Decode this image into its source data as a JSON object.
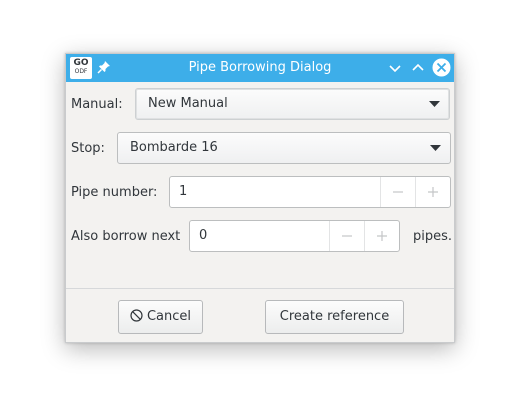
{
  "window": {
    "title": "Pipe Borrowing Dialog",
    "app_icon_top": "GO",
    "app_icon_bottom": "ODF"
  },
  "form": {
    "manual_label": "Manual:",
    "manual_value": "New Manual",
    "stop_label": "Stop:",
    "stop_value": "Bombarde 16",
    "pipe_number_label": "Pipe number:",
    "pipe_number_value": "1",
    "borrow_next_label": "Also borrow next",
    "borrow_next_value": "0",
    "pipes_suffix": "pipes."
  },
  "buttons": {
    "cancel_label": "Cancel",
    "create_label": "Create reference"
  },
  "icons": {
    "pin": "pin-icon",
    "minimize": "chevron-down-icon",
    "maximize": "chevron-up-icon",
    "close": "close-icon",
    "cancel": "cancel-circle-icon",
    "minus": "minus-icon",
    "plus": "plus-icon"
  },
  "colors": {
    "titlebar": "#3daee9",
    "window_bg": "#f3f2f0",
    "text": "#31363b"
  }
}
